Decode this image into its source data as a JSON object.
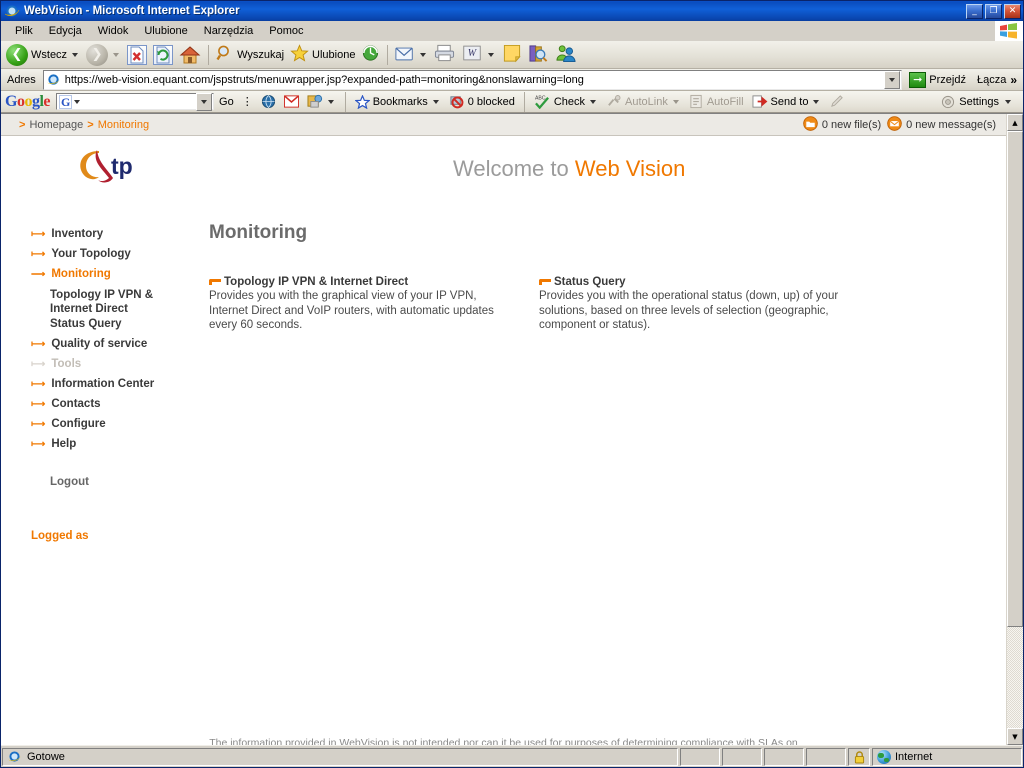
{
  "window": {
    "title": "WebVision - Microsoft Internet Explorer",
    "icon": "ie-icon",
    "minimize_label": "_",
    "restore_label": "❐",
    "close_label": "✕"
  },
  "menubar": {
    "items": [
      {
        "label": "Plik",
        "name": "menu-plik"
      },
      {
        "label": "Edycja",
        "name": "menu-edycja"
      },
      {
        "label": "Widok",
        "name": "menu-widok"
      },
      {
        "label": "Ulubione",
        "name": "menu-ulubione"
      },
      {
        "label": "Narzędzia",
        "name": "menu-narzedzia"
      },
      {
        "label": "Pomoc",
        "name": "menu-pomoc"
      }
    ]
  },
  "toolbar": {
    "back_label": "Wstecz",
    "forward_label": "",
    "stop_title": "Zatrzymaj",
    "refresh_title": "Odśwież",
    "home_title": "Strona główna",
    "search_label": "Wyszukaj",
    "favorites_label": "Ulubione",
    "history_title": "Historia",
    "mail_title": "Poczta",
    "print_title": "Drukuj",
    "edit_title": "Edytuj w programie Word",
    "notes_title": "Notatki",
    "encarta_title": "Encarta",
    "messenger_title": "Messenger"
  },
  "addressbar": {
    "label": "Adres",
    "url": "https://web-vision.equant.com/jspstruts/menuwrapper.jsp?expanded-path=monitoring&nonslawarning=long",
    "go_label": "Przejdź",
    "links_label": "Łącza",
    "overflow_label": "»"
  },
  "google_toolbar": {
    "logo": {
      "g1": "G",
      "o1": "o",
      "o2": "o",
      "g2": "g",
      "l": "l",
      "e": "e"
    },
    "search_value": "",
    "search_placeholder": "",
    "go_label": "Go",
    "items": [
      {
        "label": "Bookmarks",
        "name": "gt-bookmarks",
        "disabled": false,
        "caret": true
      },
      {
        "label": "0 blocked",
        "name": "gt-popup-blocker",
        "disabled": false,
        "caret": false
      },
      {
        "label": "Check",
        "name": "gt-spellcheck",
        "disabled": false,
        "caret": true
      },
      {
        "label": "AutoLink",
        "name": "gt-autolink",
        "disabled": true,
        "caret": true
      },
      {
        "label": "AutoFill",
        "name": "gt-autofill",
        "disabled": true,
        "caret": false
      },
      {
        "label": "Send to",
        "name": "gt-sendto",
        "disabled": false,
        "caret": true
      }
    ],
    "settings_label": "Settings"
  },
  "page": {
    "breadcrumb": {
      "sep": ">",
      "home": "Homepage",
      "current": "Monitoring"
    },
    "notifications": {
      "files": "0 new file(s)",
      "messages": "0 new message(s)"
    },
    "brand": {
      "logo_alt": "tp",
      "logo_text": "tp",
      "welcome_prefix": "Welcome to ",
      "welcome_brand": "Web Vision"
    },
    "nav": {
      "items": [
        {
          "label": "Inventory",
          "name": "sidebar-item-inventory",
          "state": "normal"
        },
        {
          "label": "Your Topology",
          "name": "sidebar-item-your-topology",
          "state": "normal"
        },
        {
          "label": "Monitoring",
          "name": "sidebar-item-monitoring",
          "state": "active"
        },
        {
          "label": "Quality of service",
          "name": "sidebar-item-quality-of-service",
          "state": "normal"
        },
        {
          "label": "Tools",
          "name": "sidebar-item-tools",
          "state": "disabled"
        },
        {
          "label": "Information Center",
          "name": "sidebar-item-information-center",
          "state": "normal"
        },
        {
          "label": "Contacts",
          "name": "sidebar-item-contacts",
          "state": "normal"
        },
        {
          "label": "Configure",
          "name": "sidebar-item-configure",
          "state": "normal"
        },
        {
          "label": "Help",
          "name": "sidebar-item-help",
          "state": "normal"
        }
      ],
      "subitems": [
        {
          "line1": "Topology IP VPN &",
          "line2": "Internet Direct",
          "name": "sidebar-subitem-topology"
        },
        {
          "line1": "Status Query",
          "line2": "",
          "name": "sidebar-subitem-status-query"
        }
      ],
      "logout_label": "Logout",
      "logged_as_label": "Logged as"
    },
    "main": {
      "title": "Monitoring",
      "cards": [
        {
          "title": "Topology IP VPN & Internet Direct",
          "body": "Provides you with the graphical view of your IP VPN, Internet Direct and VoIP routers, with automatic updates every 60 seconds.",
          "name": "card-topology-ip-vpn-internet-direct"
        },
        {
          "title": "Status Query",
          "body": "Provides you with the operational status (down, up) of your solutions, based on three levels of selection (geographic, component or status).",
          "name": "card-status-query"
        }
      ],
      "footnote": "The  information  provided  in  WebVision  is  not  intended  nor  can  it  be  used  for  purposes  of  determining  compliance  with  SLAs  on"
    }
  },
  "statusbar": {
    "status": "Gotowe",
    "zone": "Internet",
    "secure_icon": "lock-icon"
  },
  "colors": {
    "accent_orange": "#f07800",
    "brand_navy": "#1f2a6e",
    "titlebar_blue": "#0a4ec0",
    "chrome_gray": "#d4d0c8"
  }
}
